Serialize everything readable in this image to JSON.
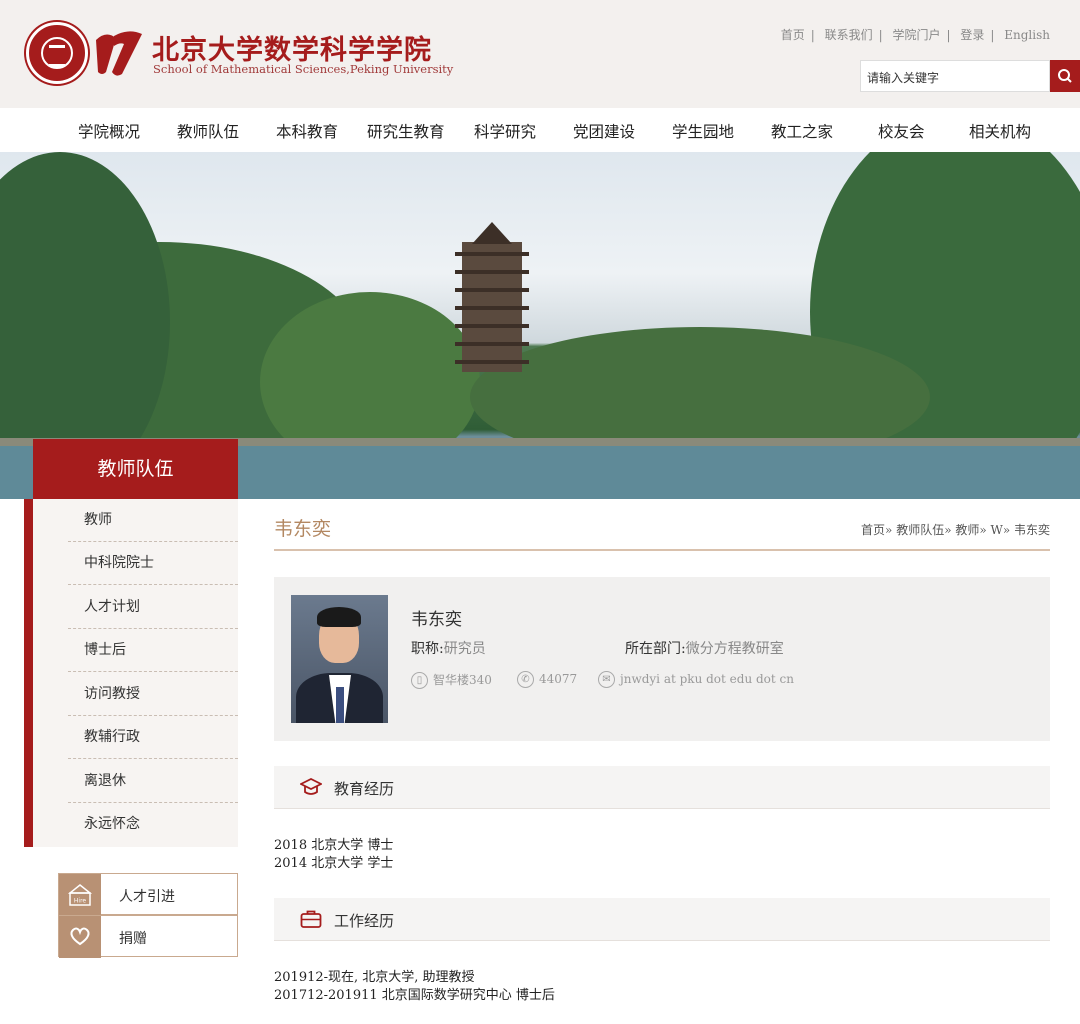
{
  "header": {
    "title_cn": "北京大学数学科学学院",
    "title_en": "School of Mathematical Sciences,Peking University",
    "top_links": [
      "首页",
      "联系我们",
      "学院门户",
      "登录",
      "English"
    ],
    "search_placeholder": "请输入关键字",
    "brand_color": "#a51c1c"
  },
  "nav": {
    "items": [
      "学院概况",
      "教师队伍",
      "本科教育",
      "研究生教育",
      "科学研究",
      "党团建设",
      "学生园地",
      "教工之家",
      "校友会",
      "相关机构"
    ]
  },
  "sidebar": {
    "title": "教师队伍",
    "items": [
      "教师",
      "中科院院士",
      "人才计划",
      "博士后",
      "访问教授",
      "教辅行政",
      "离退休",
      "永远怀念"
    ],
    "quick_links": [
      {
        "label": "人才引进",
        "icon": "hire-icon"
      },
      {
        "label": "捐赠",
        "icon": "heart-icon"
      }
    ]
  },
  "main": {
    "page_title": "韦东奕",
    "breadcrumb": "首页» 教师队伍» 教师» W» 韦东奕",
    "profile": {
      "name": "韦东奕",
      "title_label": "职称:",
      "title_value": "研究员",
      "dept_label": "所在部门:",
      "dept_value": "微分方程教研室",
      "office": "智华楼340",
      "phone": "44077",
      "email": "jnwdyi at pku dot edu dot cn"
    },
    "education": {
      "heading": "教育经历",
      "lines": [
        "2018 北京大学 博士",
        "2014 北京大学 学士"
      ]
    },
    "work": {
      "heading": "工作经历",
      "lines": [
        "201912-现在, 北京大学, 助理教授",
        "201712-201911 北京国际数学研究中心 博士后"
      ]
    }
  }
}
